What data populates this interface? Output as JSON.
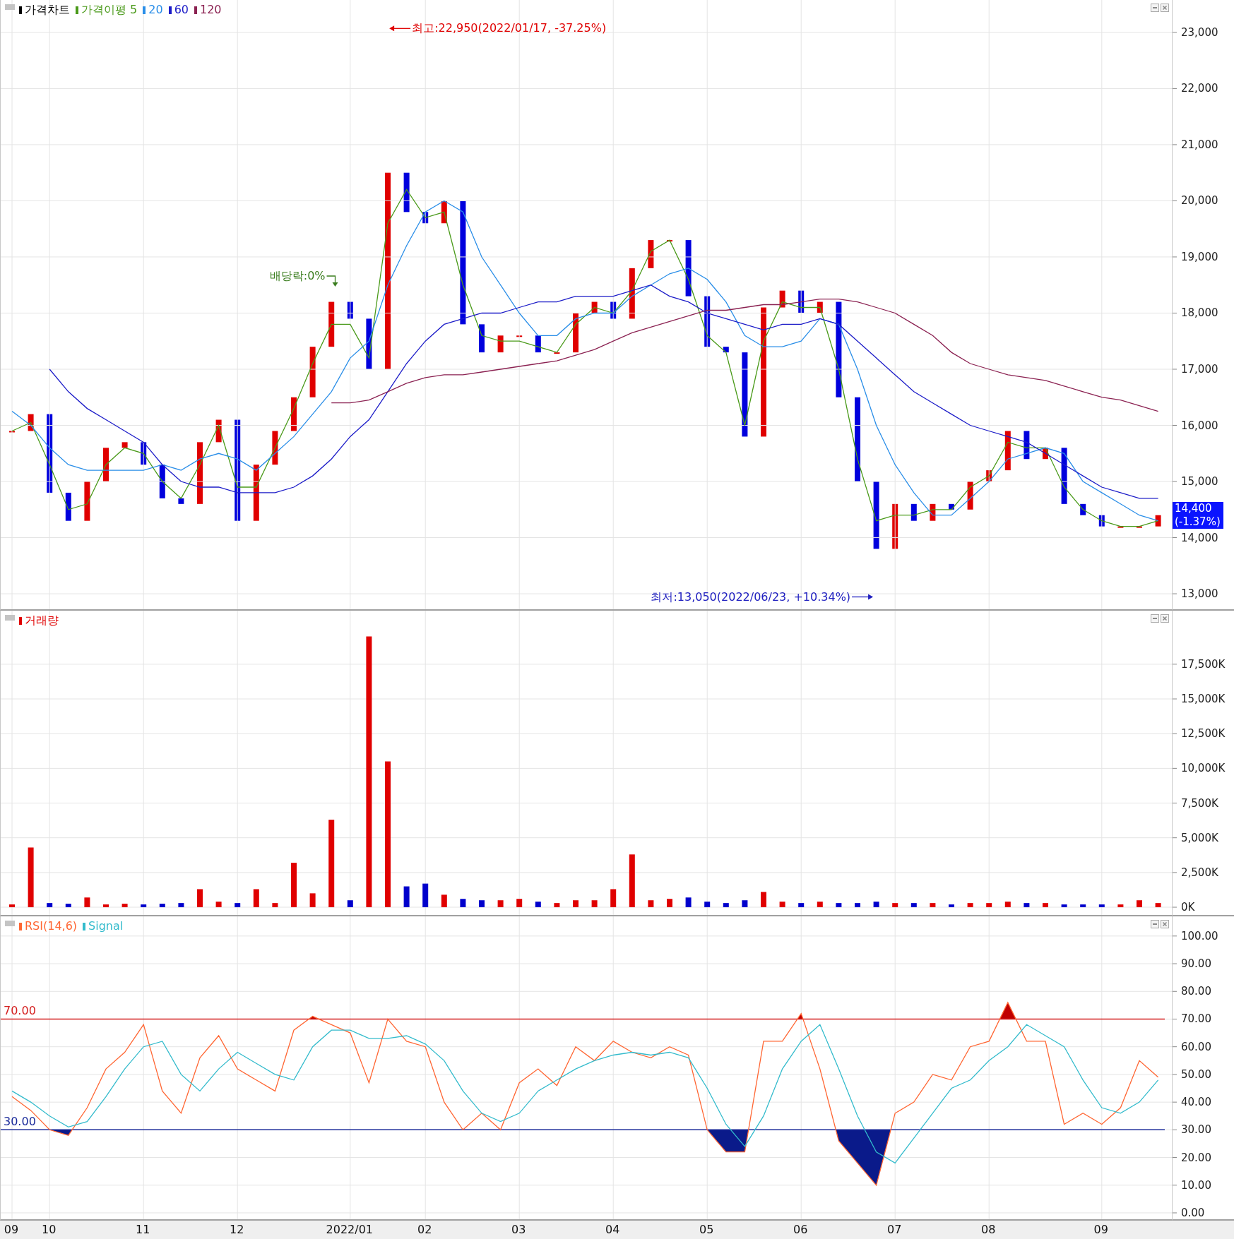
{
  "price_panel": {
    "legend_title": "가격차트",
    "chart_data": {
      "type": "line",
      "ylim": [
        12724,
        23577
      ],
      "grid": true,
      "legend": "top-left",
      "categories": [
        null,
        null,
        null,
        null,
        null,
        null,
        null,
        null,
        null,
        null,
        null,
        null,
        null,
        null,
        null,
        null,
        null,
        null,
        null,
        null,
        null,
        null,
        null,
        null,
        null,
        null,
        null,
        null,
        null,
        null,
        null,
        null,
        null,
        null,
        null,
        null,
        null,
        null,
        null,
        null,
        null,
        null,
        null,
        null,
        null,
        null,
        null,
        null,
        null,
        null,
        null,
        null,
        null,
        null,
        null,
        null,
        null,
        null,
        null,
        null,
        null,
        null
      ],
      "yticks": [
        {
          "value": 13000,
          "label": "13,000"
        },
        {
          "value": 14000,
          "label": "14,000"
        },
        {
          "value": 15000,
          "label": "15,000"
        },
        {
          "value": 16000,
          "label": "16,000"
        },
        {
          "value": 17000,
          "label": "17,000"
        },
        {
          "value": 18000,
          "label": "18,000"
        },
        {
          "value": 19000,
          "label": "19,000"
        },
        {
          "value": 20000,
          "label": "20,000"
        },
        {
          "value": 21000,
          "label": "21,000"
        },
        {
          "value": 22000,
          "label": "22,000"
        },
        {
          "value": 23000,
          "label": "23,000"
        }
      ],
      "series": [
        {
          "name": "가격이평 5",
          "color": "#4a9a1a",
          "values": [
            15900,
            16050,
            15300,
            14500,
            14600,
            15300,
            15600,
            15500,
            15000,
            14700,
            15300,
            16000,
            14900,
            14900,
            15600,
            16300,
            17100,
            17800,
            17800,
            17200,
            19600,
            20200,
            19700,
            19800,
            18500,
            17600,
            17500,
            17500,
            17400,
            17300,
            17800,
            18100,
            18000,
            18400,
            19100,
            19300,
            18600,
            17600,
            17300,
            16000,
            17500,
            18200,
            18100,
            18100,
            17000,
            15400,
            14300,
            14400,
            14400,
            14500,
            14500,
            14900,
            15100,
            15700,
            15600,
            15600,
            14900,
            14500,
            14300,
            14200,
            14200,
            14300
          ]
        },
        {
          "name": "20",
          "color": "#2a8ee8",
          "values": [
            16250,
            16000,
            15600,
            15300,
            15200,
            15200,
            15200,
            15200,
            15300,
            15200,
            15400,
            15500,
            15400,
            15200,
            15500,
            15800,
            16200,
            16600,
            17200,
            17500,
            18500,
            19200,
            19800,
            20000,
            19800,
            19000,
            18500,
            18000,
            17600,
            17600,
            17900,
            18000,
            18000,
            18300,
            18500,
            18700,
            18800,
            18600,
            18200,
            17600,
            17400,
            17400,
            17500,
            17900,
            17800,
            17000,
            16000,
            15300,
            14800,
            14400,
            14400,
            14700,
            15000,
            15400,
            15500,
            15600,
            15500,
            15000,
            14800,
            14600,
            14400,
            14300
          ]
        },
        {
          "name": "60",
          "color": "#1c1cc8",
          "values": [
            null,
            null,
            17000,
            16600,
            16300,
            16100,
            15900,
            15700,
            15300,
            15000,
            14900,
            14900,
            14800,
            14800,
            14800,
            14900,
            15100,
            15400,
            15800,
            16100,
            16600,
            17100,
            17500,
            17800,
            17900,
            18000,
            18000,
            18100,
            18200,
            18200,
            18300,
            18300,
            18300,
            18400,
            18500,
            18300,
            18200,
            18000,
            17900,
            17800,
            17700,
            17800,
            17800,
            17900,
            17800,
            17500,
            17200,
            16900,
            16600,
            16400,
            16200,
            16000,
            15900,
            15800,
            15700,
            15500,
            15300,
            15100,
            14900,
            14800,
            14700,
            14700
          ]
        },
        {
          "name": "120",
          "color": "#8b2252",
          "values": [
            null,
            null,
            null,
            null,
            null,
            null,
            null,
            null,
            null,
            null,
            null,
            null,
            null,
            null,
            null,
            null,
            null,
            16400,
            16400,
            16450,
            16600,
            16750,
            16850,
            16900,
            16900,
            16950,
            17000,
            17050,
            17100,
            17150,
            17250,
            17350,
            17500,
            17650,
            17750,
            17850,
            17950,
            18050,
            18050,
            18100,
            18150,
            18150,
            18200,
            18250,
            18250,
            18200,
            18100,
            18000,
            17800,
            17600,
            17300,
            17100,
            17000,
            16900,
            16850,
            16800,
            16700,
            16600,
            16500,
            16450,
            16350,
            16250
          ]
        }
      ],
      "annotations": [
        "최고:22,950(2022/01/17, -37.25%)",
        "배당락:0%",
        "최저:13,050(2022/06/23, +10.34%)"
      ]
    },
    "price_tag": {
      "value": "14,400",
      "change": "(-1.37%)"
    }
  },
  "volume_panel": {
    "chart_data": {
      "type": "bar",
      "ylim": [
        -557,
        21356
      ],
      "grid": true,
      "legend": "top-left",
      "stacked": true,
      "categories": [
        null,
        null,
        null,
        null,
        null,
        null,
        null,
        null,
        null,
        null,
        null,
        null,
        null,
        null,
        null,
        null,
        null,
        null,
        null,
        null,
        null,
        null,
        null,
        null,
        null,
        null,
        null,
        null,
        null,
        null,
        null,
        null,
        null,
        null,
        null,
        null,
        null,
        null,
        null,
        null,
        null,
        null,
        null,
        null,
        null,
        null,
        null,
        null,
        null,
        null,
        null,
        null,
        null,
        null,
        null,
        null,
        null,
        null,
        null,
        null,
        null,
        null
      ],
      "yticks": [
        {
          "value": 0,
          "label": "0K"
        },
        {
          "value": 2500,
          "label": "2,500K"
        },
        {
          "value": 5000,
          "label": "5,000K"
        },
        {
          "value": 7500,
          "label": "7,500K"
        },
        {
          "value": 10000,
          "label": "10,000K"
        },
        {
          "value": 12500,
          "label": "12,500K"
        },
        {
          "value": 15000,
          "label": "15,000K"
        },
        {
          "value": 17500,
          "label": "17,500K"
        }
      ],
      "series": [
        {
          "name": "거래량",
          "color": "#e00000",
          "values": [
            200,
            4300,
            null,
            null,
            700,
            200,
            250,
            null,
            null,
            null,
            1300,
            400,
            null,
            1300,
            300,
            3200,
            1000,
            6300,
            null,
            19500,
            10500,
            null,
            null,
            900,
            null,
            null,
            500,
            600,
            null,
            300,
            500,
            500,
            1300,
            3800,
            500,
            600,
            null,
            null,
            null,
            null,
            1100,
            400,
            null,
            400,
            null,
            null,
            null,
            300,
            null,
            300,
            null,
            300,
            300,
            400,
            null,
            300,
            null,
            null,
            null,
            200,
            500,
            300
          ]
        },
        {
          "color": "#0000cc",
          "values": [
            null,
            null,
            300,
            250,
            null,
            null,
            null,
            200,
            250,
            300,
            null,
            null,
            300,
            null,
            null,
            null,
            null,
            null,
            500,
            null,
            null,
            1500,
            1700,
            null,
            600,
            500,
            null,
            null,
            400,
            null,
            null,
            null,
            null,
            null,
            null,
            null,
            700,
            400,
            300,
            500,
            null,
            null,
            300,
            null,
            300,
            300,
            400,
            null,
            300,
            null,
            200,
            null,
            null,
            null,
            300,
            null,
            200,
            200,
            200,
            null,
            null,
            null
          ]
        }
      ]
    }
  },
  "rsi_panel": {
    "chart_data": {
      "type": "line",
      "ylim": [
        -2.3,
        107.1
      ],
      "grid": true,
      "legend": "top-left",
      "categories": [
        "09",
        null,
        "10",
        null,
        null,
        null,
        null,
        "11",
        null,
        null,
        null,
        null,
        "12",
        null,
        null,
        null,
        null,
        null,
        "2022/01",
        null,
        null,
        null,
        "02",
        null,
        null,
        null,
        null,
        "03",
        null,
        null,
        null,
        null,
        "04",
        null,
        null,
        null,
        null,
        "05",
        null,
        null,
        null,
        null,
        "06",
        null,
        null,
        null,
        null,
        "07",
        null,
        null,
        null,
        null,
        "08",
        null,
        null,
        null,
        null,
        null,
        "09",
        null,
        null,
        null
      ],
      "yticks": [
        {
          "value": 0,
          "label": "0.00"
        },
        {
          "value": 10,
          "label": "10.00"
        },
        {
          "value": 20,
          "label": "20.00"
        },
        {
          "value": 30,
          "label": "30.00"
        },
        {
          "value": 40,
          "label": "40.00"
        },
        {
          "value": 50,
          "label": "50.00"
        },
        {
          "value": 60,
          "label": "60.00"
        },
        {
          "value": 70,
          "label": "70.00"
        },
        {
          "value": 80,
          "label": "80.00"
        },
        {
          "value": 90,
          "label": "90.00"
        },
        {
          "value": 100,
          "label": "100.00"
        }
      ],
      "series": [
        {
          "name": "RSI(14,6)",
          "color": "#ff6633",
          "values": [
            42,
            37,
            30,
            28,
            38,
            52,
            58,
            68,
            44,
            36,
            56,
            64,
            52,
            48,
            44,
            66,
            71,
            68,
            65,
            47,
            70,
            62,
            60,
            40,
            30,
            36,
            30,
            47,
            52,
            46,
            60,
            55,
            62,
            58,
            56,
            60,
            57,
            30,
            22,
            22,
            62,
            62,
            72,
            52,
            26,
            18,
            10,
            36,
            40,
            50,
            48,
            60,
            62,
            76,
            62,
            62,
            32,
            36,
            32,
            38,
            55,
            49
          ]
        },
        {
          "name": "Signal",
          "color": "#33bbcc",
          "values": [
            44,
            40,
            35,
            31,
            33,
            42,
            52,
            60,
            62,
            50,
            44,
            52,
            58,
            54,
            50,
            48,
            60,
            66,
            66,
            63,
            63,
            64,
            61,
            55,
            44,
            36,
            33,
            36,
            44,
            48,
            52,
            55,
            57,
            58,
            57,
            58,
            56,
            45,
            32,
            24,
            35,
            52,
            62,
            68,
            52,
            35,
            22,
            18,
            27,
            36,
            45,
            48,
            55,
            60,
            68,
            64,
            60,
            48,
            38,
            36,
            40,
            48
          ]
        }
      ],
      "ref_lines": [
        {
          "axis": "y",
          "value": 70,
          "label": "70.00"
        },
        {
          "axis": "y",
          "value": 30,
          "label": "30.00"
        }
      ]
    }
  }
}
